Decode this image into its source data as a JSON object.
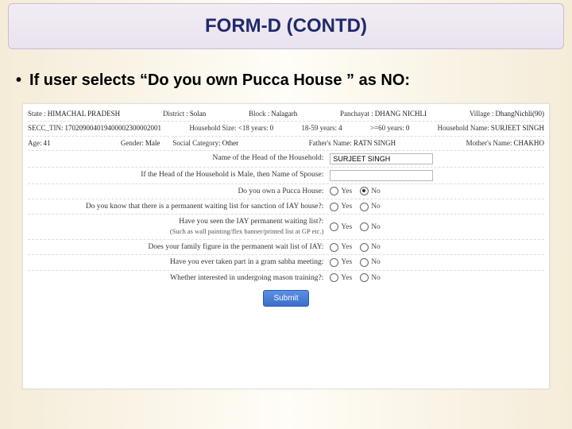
{
  "title": "FORM-D (CONTD)",
  "bullet": "If user selects “Do you own Pucca House ” as NO:",
  "info1": {
    "state_lbl": "State :",
    "state_val": "HIMACHAL PRADESH",
    "district_lbl": "District :",
    "district_val": "Solan",
    "block_lbl": "Block :",
    "block_val": "Nalagarh",
    "panchayat_lbl": "Panchayat :",
    "panchayat_val": "DHANG NICHLI",
    "village_lbl": "Village :",
    "village_val": "DhangNichli(90)"
  },
  "info2": {
    "tin_lbl": "SECC_TIN:",
    "tin_val": "170209004019400002300002001",
    "hh_lbl": "Household Size: <18 years:",
    "hh_val": "0",
    "age1859_lbl": "18-59 years:",
    "age1859_val": "4",
    "age60_lbl": ">=60 years:",
    "age60_val": "0",
    "hhname_lbl": "Household Name:",
    "hhname_val": "SURJEET SINGH"
  },
  "info3": {
    "age_lbl": "Age:",
    "age_val": "41",
    "gender_lbl": "Gender:",
    "gender_val": "Male",
    "soc_lbl": "Social Category:",
    "soc_val": "Other",
    "father_lbl": "Father's Name:",
    "father_val": "RATN SINGH",
    "mother_lbl": "Mother's Name:",
    "mother_val": "CHAKHO"
  },
  "q": {
    "head_lbl": "Name of the Head of the Household:",
    "head_val": "SURJEET SINGH",
    "spouse_lbl": "If the Head of the Household is Male, then Name of Spouse:",
    "spouse_val": "",
    "pucca_lbl": "Do you own a Pucca House:",
    "wait_lbl": "Do you know that there is a permanent waiting list for sanction of IAY house?:",
    "seen_lbl": "Have you seen the IAY permanent waiting list?:",
    "seen_sub": "(Such as wall painting/flex banner/printed list at GP etc.)",
    "figure_lbl": "Does your family figure in the permanent wait list of IAY:",
    "gram_lbl": "Have you ever taken part in a gram sabha meeting:",
    "mason_lbl": "Whether interested in undergoing mason training?:"
  },
  "opt": {
    "yes": "Yes",
    "no": "No"
  },
  "radio": {
    "pucca": "No",
    "wait": "",
    "seen": "",
    "figure": "",
    "gram": "",
    "mason": ""
  },
  "submit": "Submit"
}
